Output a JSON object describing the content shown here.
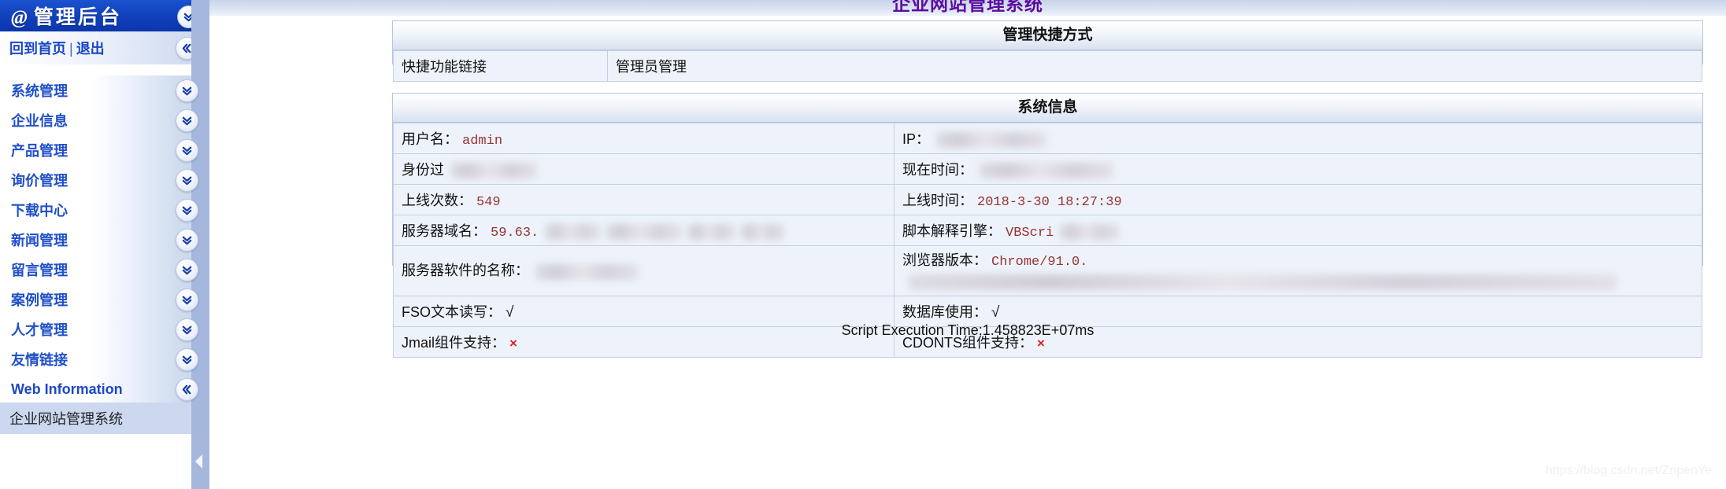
{
  "sidebar": {
    "header": {
      "at": "@",
      "title": "管理后台",
      "toggle_icon": "chevron-double-down-icon"
    },
    "topbar": {
      "home_label": "回到首页",
      "separator": "|",
      "logout_label": "退出",
      "collapse_icon": "chevron-double-left-icon"
    },
    "items": [
      {
        "label": "系统管理",
        "icon": "chevron-double-down-icon"
      },
      {
        "label": "企业信息",
        "icon": "chevron-double-down-icon"
      },
      {
        "label": "产品管理",
        "icon": "chevron-double-down-icon"
      },
      {
        "label": "询价管理",
        "icon": "chevron-double-down-icon"
      },
      {
        "label": "下载中心",
        "icon": "chevron-double-down-icon"
      },
      {
        "label": "新闻管理",
        "icon": "chevron-double-down-icon"
      },
      {
        "label": "留言管理",
        "icon": "chevron-double-down-icon"
      },
      {
        "label": "案例管理",
        "icon": "chevron-double-down-icon"
      },
      {
        "label": "人才管理",
        "icon": "chevron-double-down-icon"
      },
      {
        "label": "友情链接",
        "icon": "chevron-double-down-icon"
      },
      {
        "label": "Web Information",
        "icon": "chevron-double-left-icon"
      }
    ],
    "footer_label": "企业网站管理系统"
  },
  "splitter": {
    "icon": "triangle-left-icon"
  },
  "main": {
    "page_title": "企业网站管理系统",
    "quick": {
      "heading": "管理快捷方式",
      "row_label": "快捷功能链接",
      "row_value": "管理员管理"
    },
    "sysinfo": {
      "heading": "系统信息",
      "rows": [
        {
          "left_label": "用户名：",
          "left_value": "admin",
          "left_redacted": false,
          "right_label": "IP：",
          "right_value": "",
          "right_redacted": true
        },
        {
          "left_label": "身份过",
          "left_value": "",
          "left_redacted": true,
          "right_label": "现在时间：",
          "right_value": "",
          "right_redacted": true
        },
        {
          "left_label": "上线次数：",
          "left_value": "549",
          "left_redacted": false,
          "right_label": "上线时间：",
          "right_value": "2018-3-30 18:27:39",
          "right_redacted": false
        },
        {
          "left_label": "服务器域名：",
          "left_value": "59.63.",
          "left_redacted": true,
          "right_label": "脚本解释引擎：",
          "right_value": "VBScri",
          "right_redacted": true
        },
        {
          "left_label": "服务器软件的名称：",
          "left_value": "",
          "left_redacted": true,
          "right_label": "浏览器版本：",
          "right_value": "Chrome/91.0.",
          "right_redacted": true
        },
        {
          "left_label": "FSO文本读写：",
          "left_value": "√",
          "left_redacted": false,
          "right_label": "数据库使用：",
          "right_value": "√",
          "right_redacted": false
        },
        {
          "left_label": "Jmail组件支持：",
          "left_value": "×",
          "left_redacted": false,
          "right_label": "CDONTS组件支持：",
          "right_value": "×",
          "right_redacted": false
        }
      ]
    },
    "footer_note": "Script Execution Time:1.458823E+07ms",
    "watermark": "https://blog.csdn.net/ZripenYe"
  }
}
